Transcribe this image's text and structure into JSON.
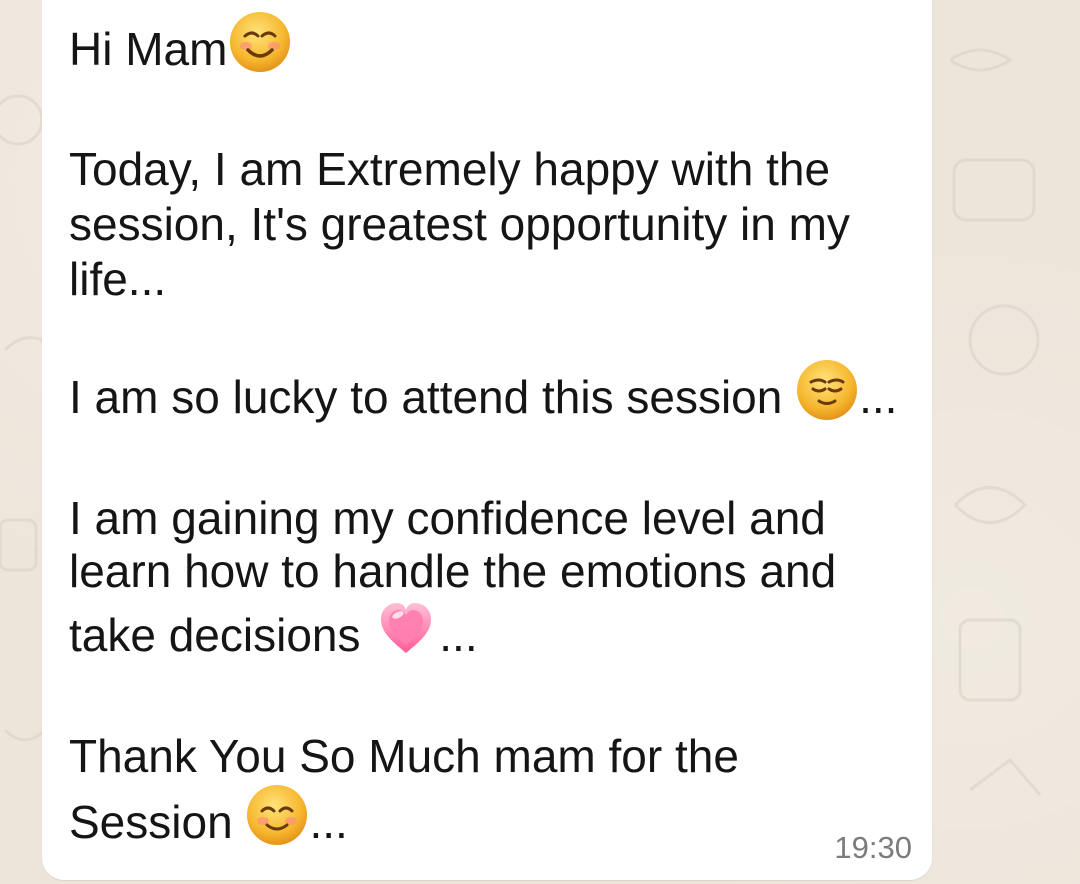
{
  "chat": {
    "message": {
      "greeting": "Hi Mam",
      "paragraph1_line1": "Today, I am Extremely happy with the",
      "paragraph1_line2": "session, It's greatest opportunity in my",
      "paragraph1_line3": "life...",
      "paragraph2": "I am so lucky to attend this session",
      "paragraph2_suffix": "...",
      "paragraph3_line1": "I am gaining my confidence level and",
      "paragraph3_line2": "learn how to handle the emotions and",
      "paragraph3_line3": "take decisions",
      "paragraph3_suffix": "...",
      "paragraph4_line1": "Thank You So Much mam  for the",
      "paragraph4_line2": "Session",
      "paragraph4_suffix": "...",
      "timestamp": "19:30"
    },
    "emojis": {
      "greeting": "smiling-face-icon",
      "lucky": "relieved-face-icon",
      "decisions": "pink-heart-icon",
      "session": "smiling-blush-face-icon"
    },
    "colors": {
      "background": "#ece5da",
      "bubble": "#ffffff",
      "text": "#151515",
      "timestamp": "#7c7c7c"
    }
  }
}
